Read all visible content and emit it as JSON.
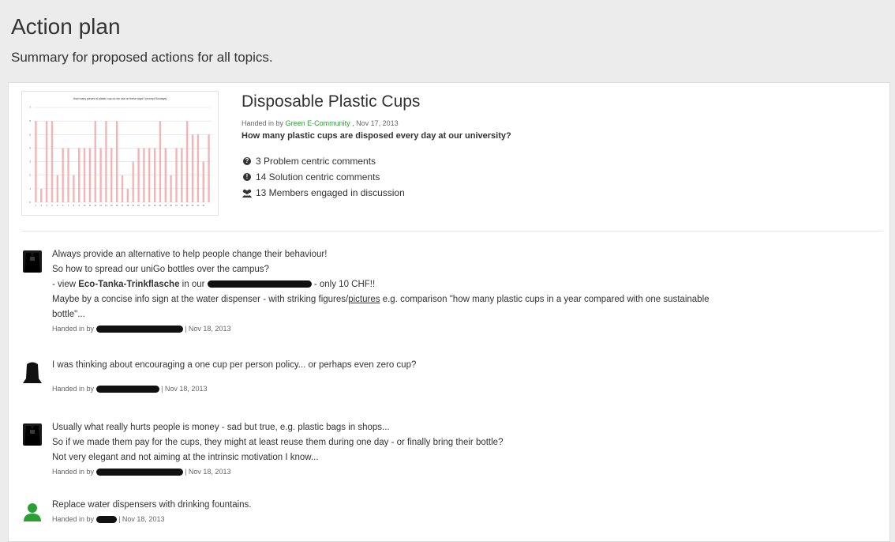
{
  "page": {
    "title": "Action plan",
    "subtitle": "Summary for proposed actions for all topics."
  },
  "topic": {
    "title": "Disposable Plastic Cups",
    "handed_prefix": "Handed in by",
    "author": "Green E-Community",
    "date": ", Nov 17, 2013",
    "question": "How many plastic cups are disposed every day at our university?",
    "stats": [
      {
        "icon": "question-circle-icon",
        "text": "3 Problem centric comments"
      },
      {
        "icon": "exclamation-circle-icon",
        "text": "14 Solution centric comments"
      },
      {
        "icon": "users-icon",
        "text": "13 Members engaged in discussion"
      }
    ],
    "thumbnail_title": "How many pieces of plastic cup do we use on these days? (except Sundays)"
  },
  "chart_data": {
    "type": "bar",
    "title": "How many pieces of plastic cup do we use on these days? (except Sundays)",
    "categories": [
      "1",
      "2",
      "3",
      "4",
      "5",
      "6",
      "7",
      "8",
      "9",
      "10",
      "11",
      "12",
      "13",
      "14",
      "15",
      "16",
      "17",
      "18",
      "19",
      "20",
      "21",
      "22",
      "23",
      "24",
      "25",
      "26",
      "27",
      "28",
      "29",
      "30",
      "31",
      "32"
    ],
    "values": [
      6,
      1,
      6,
      6,
      2,
      4,
      4,
      2,
      4,
      4,
      4,
      6,
      4,
      6,
      4,
      6,
      2,
      1,
      3,
      4,
      4,
      4,
      4,
      6,
      4,
      2,
      4,
      4,
      6,
      5,
      5,
      3,
      5
    ],
    "ylim": [
      0,
      7
    ],
    "grid": true,
    "color": "#f4b4b4"
  },
  "comments": [
    {
      "avatar": "user-photo-icon",
      "lines": {
        "l1": "Always provide an alternative to help people change their behaviour!",
        "l2": "So how to spread our uniGo bottles over the campus?",
        "l3_a": "- view ",
        "l3_bold": "Eco-Tanka-Trinkflasche",
        "l3_b": " in our ",
        "l3_c": " - only 10 CHF!!",
        "l4_a": "Maybe by a concise info sign at the water dispenser - with striking figures/",
        "l4_u": "pictures",
        "l4_b": " e.g. comparison \"how many plastic cups in a year compared with one sustainable",
        "l5": "bottle\"..."
      },
      "meta_prefix": "Handed in by",
      "meta_date": "| Nov 18, 2013"
    },
    {
      "avatar": "user-silhouette-icon",
      "lines": {
        "l1": "I was thinking about encouraging a one cup per person policy... or perhaps even zero cup?"
      },
      "meta_prefix": "Handed in by",
      "meta_date": "| Nov 18, 2013"
    },
    {
      "avatar": "user-photo-icon",
      "lines": {
        "l1": "Usually what really hurts people is money - sad but true, e.g. plastic bags in shops...",
        "l2": "So if we made them pay for the cups, they might at least reuse them during one day - or finally bring their bottle?",
        "l3": "Not very elegant and not aiming at the intrinsic motivation I know..."
      },
      "meta_prefix": "Handed in by",
      "meta_date": "| Nov 18, 2013"
    },
    {
      "avatar": "user-default-icon",
      "lines": {
        "l1": "Replace water dispensers with drinking fountains."
      },
      "meta_prefix": "Handed in by",
      "meta_date": "| Nov 18, 2013"
    }
  ]
}
